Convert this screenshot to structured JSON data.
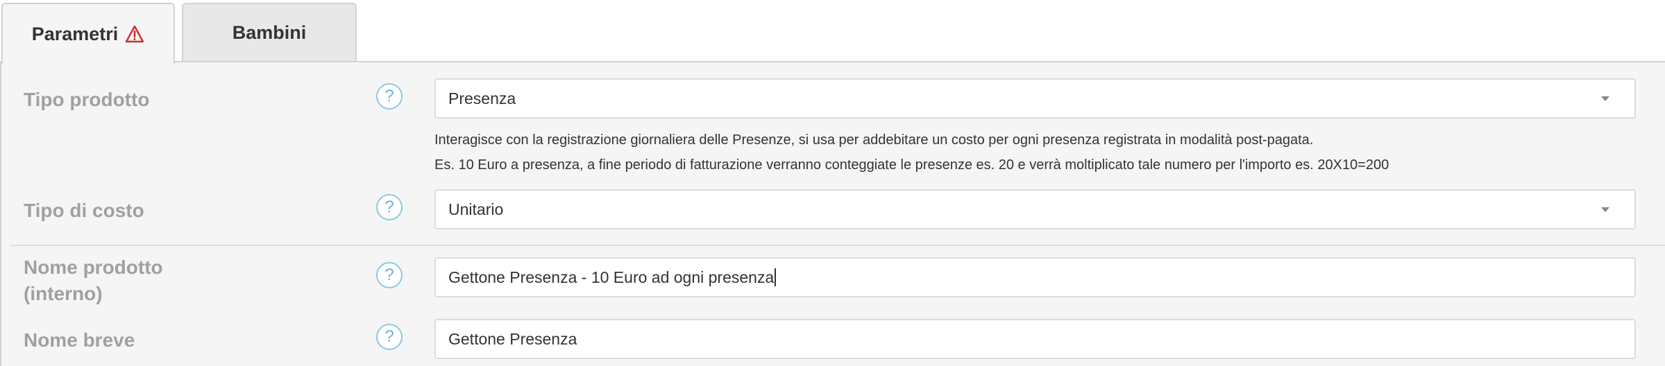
{
  "tabs": [
    {
      "label": "Parametri",
      "icon": "warning-triangle-icon",
      "icon_color": "#c9302c",
      "active": true
    },
    {
      "label": "Bambini",
      "active": false
    }
  ],
  "help_glyph": "?",
  "form": {
    "tipo_prodotto": {
      "label": "Tipo prodotto",
      "value": "Presenza",
      "help_line1": "Interagisce con la registrazione giornaliera delle Presenze, si usa per addebitare un costo per ogni presenza registrata in modalità post-pagata.",
      "help_line2": "Es. 10 Euro a presenza, a fine periodo di fatturazione verranno conteggiate le presenze es. 20 e verrà moltiplicato tale numero per l'importo es. 20X10=200"
    },
    "tipo_costo": {
      "label": "Tipo di costo",
      "value": "Unitario"
    },
    "nome_prodotto": {
      "label_line1": "Nome prodotto",
      "label_line2": "(interno)",
      "value": "Gettone Presenza - 10 Euro ad ogni presenza"
    },
    "nome_breve": {
      "label": "Nome breve",
      "value": "Gettone Presenza"
    }
  },
  "colors": {
    "label": "#a0a0a0",
    "help_icon": "#6bb3d9",
    "panel_bg": "#f5f5f5"
  }
}
